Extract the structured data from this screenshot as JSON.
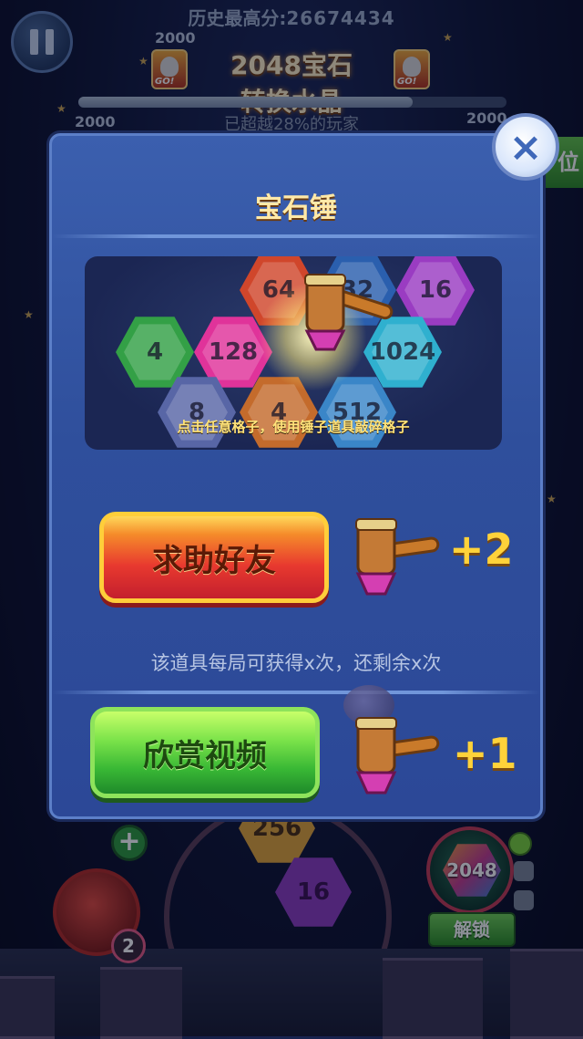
{
  "hud": {
    "high_score_label": "历史最高分:",
    "high_score_value": "26674434",
    "left_score_top": "2000",
    "left_score_bottom": "2000",
    "right_score_bottom": "2000",
    "title_line1": "2048宝石",
    "title_line2": "转换水晶",
    "percent_text": "已超越28%的玩家",
    "avatar_go": "GO!",
    "side_tab": "位",
    "progress": 0.78
  },
  "board": {
    "tile_a": "256",
    "tile_b": "16",
    "count_badge": "2",
    "plus": "+",
    "target_tile": "2048",
    "unlock_label": "解锁"
  },
  "modal": {
    "title": "宝石锤",
    "preview_caption": "点击任意格子，使用锤子道具敲碎格子",
    "preview_tiles": [
      {
        "label": "64",
        "color": "#d0462b"
      },
      {
        "label": "32",
        "color": "#2a5fae"
      },
      {
        "label": "16",
        "color": "#9a3cc2"
      },
      {
        "label": "4",
        "color": "#33a046"
      },
      {
        "label": "128",
        "color": "#e0339a"
      },
      {
        "label": "1024",
        "color": "#2fb0cf"
      },
      {
        "label": "8",
        "color": "#5866a6"
      },
      {
        "label": "4",
        "color": "#c46b2c"
      },
      {
        "label": "512",
        "color": "#3a86c8"
      }
    ],
    "help_button_label": "求助好友",
    "help_reward": "+2",
    "info_text": "该道具每局可获得x次，还剩余x次",
    "video_button_label": "欣赏视频",
    "video_reward": "+1",
    "close_icon": "×"
  }
}
